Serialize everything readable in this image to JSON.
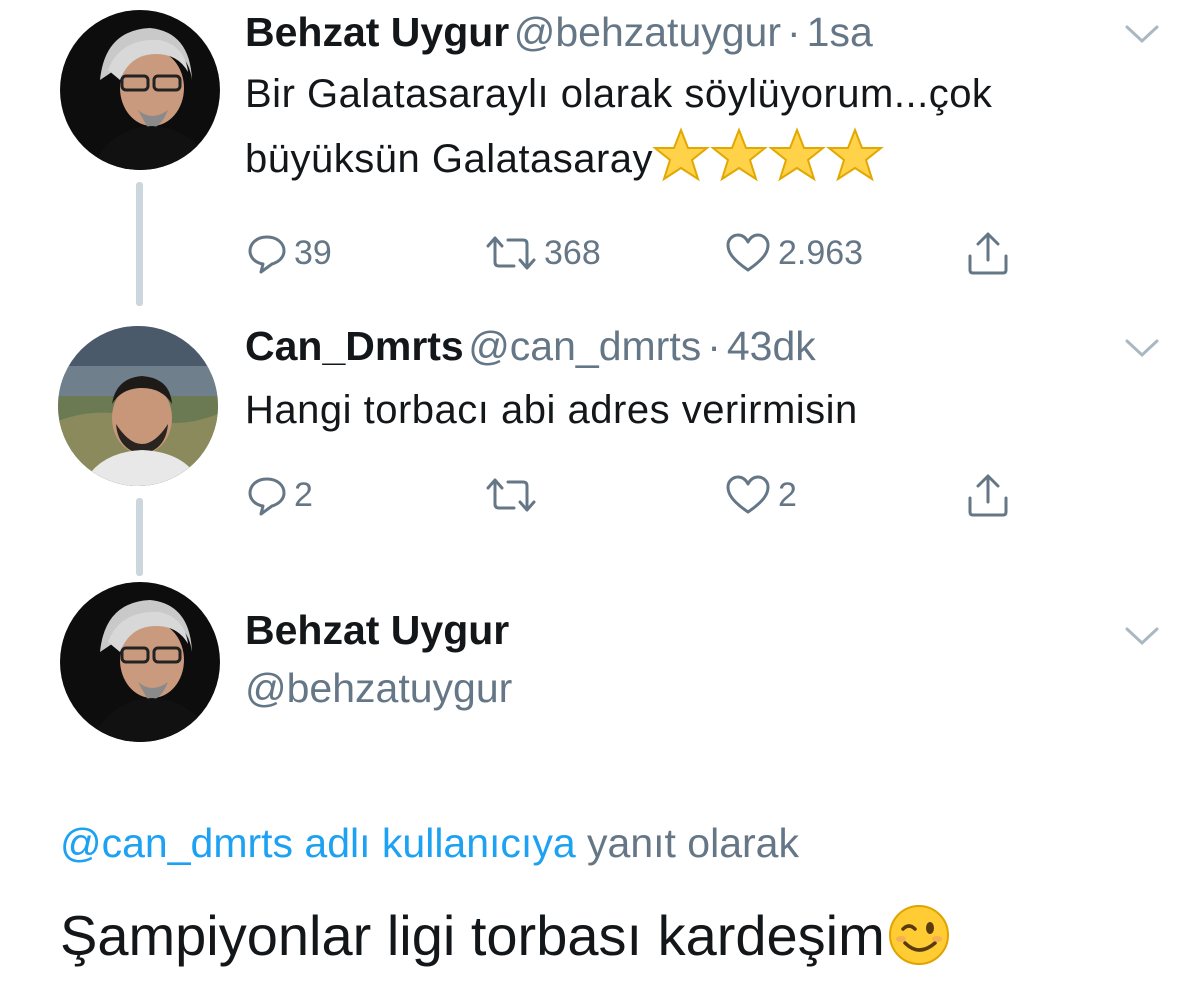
{
  "tweets": [
    {
      "name": "Behzat Uygur",
      "handle": "@behzatuygur",
      "separator": "·",
      "time": "1sa",
      "text_line1": "Bir Galatasaraylı olarak söylüyorum...çok",
      "text_line2": "büyüksün Galatasaray",
      "emoji_icons": [
        "star-icon",
        "star-icon",
        "star-icon",
        "star-icon"
      ],
      "replies": "39",
      "retweets": "368",
      "likes": "2.963"
    },
    {
      "name": "Can_Dmrts",
      "handle": "@can_dmrts",
      "separator": "·",
      "time": "43dk",
      "text_line1": "Hangi torbacı abi adres verirmisin",
      "replies": "2",
      "retweets": "",
      "likes": "2"
    }
  ],
  "focused_tweet": {
    "name": "Behzat Uygur",
    "handle": "@behzatuygur",
    "reply_link": "@can_dmrts adlı kullanıcıya",
    "reply_suffix": "yanıt olarak",
    "text": "Şampiyonlar ligi torbası kardeşim",
    "emoji_icon": "winking-face-icon"
  },
  "colors": {
    "link": "#1da1f2",
    "secondary_text": "#657786",
    "thread_line": "#ccd6dd",
    "star": "#ffd24a"
  }
}
